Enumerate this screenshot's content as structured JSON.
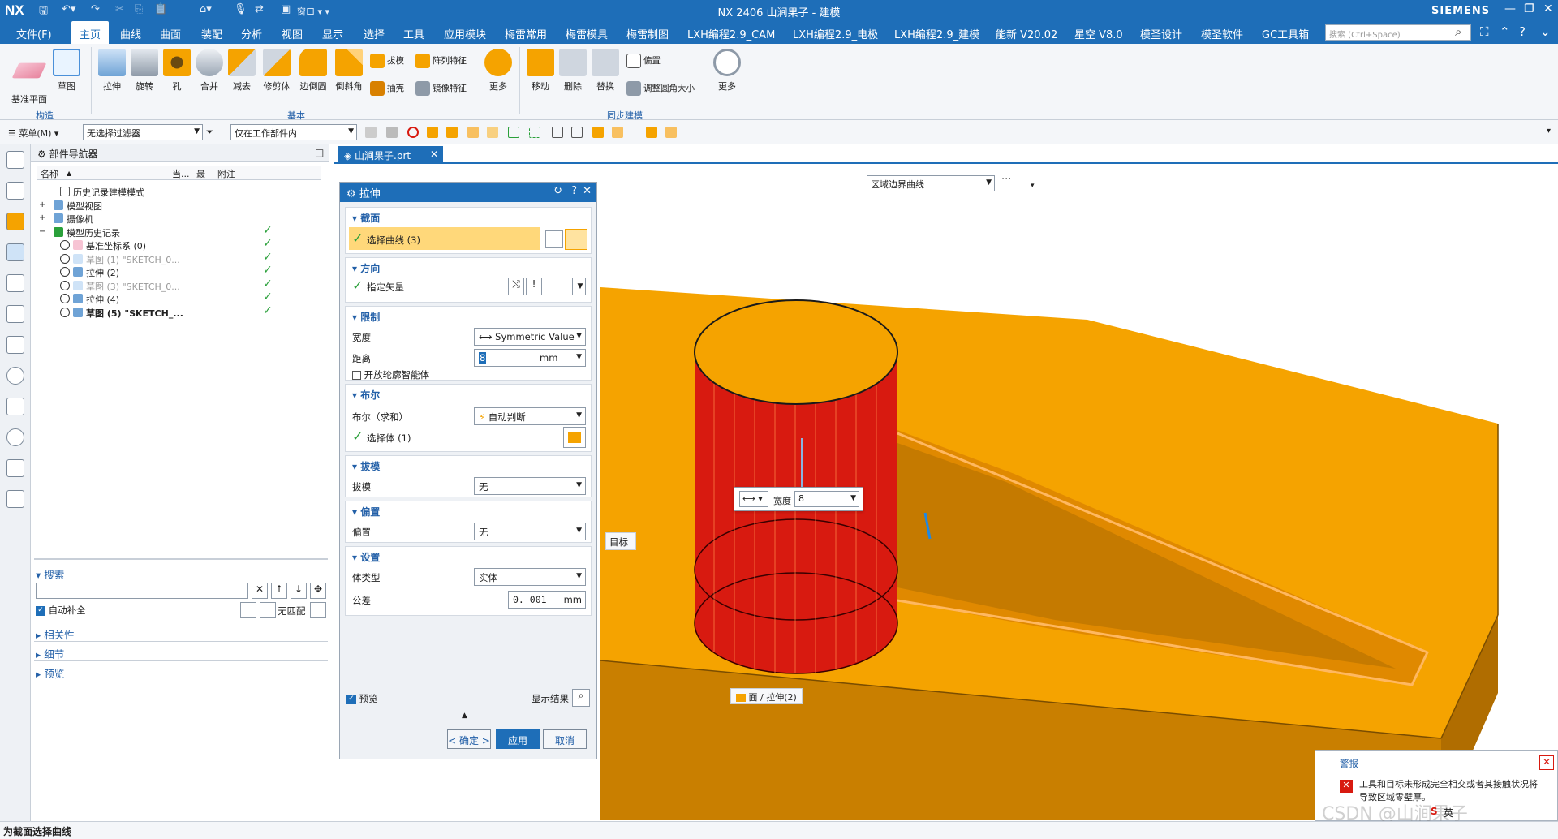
{
  "titlebar": {
    "logo": "NX",
    "window_menu": "窗口",
    "title": "NX 2406 山涧果子 - 建模",
    "brand": "SIEMENS"
  },
  "menubar": {
    "items": [
      "文件(F)",
      "主页",
      "曲线",
      "曲面",
      "装配",
      "分析",
      "视图",
      "显示",
      "选择",
      "工具",
      "应用模块",
      "梅雷常用",
      "梅雷模具",
      "梅雷制图",
      "LXH编程2.9_CAM",
      "LXH编程2.9_电极",
      "LXH编程2.9_建模",
      "能新 V20.02",
      "星空 V8.0",
      "模圣设计",
      "模圣软件",
      "GC工具箱"
    ],
    "search_placeholder": "搜索 (Ctrl+Space)"
  },
  "ribbon": {
    "construct": [
      "基准平面",
      "草图"
    ],
    "basic_large": [
      "拉伸",
      "旋转",
      "孔",
      "合并",
      "减去",
      "修剪体",
      "边倒圆",
      "倒斜角"
    ],
    "basic_small": [
      "拔模",
      "阵列特征",
      "抽壳",
      "镜像特征"
    ],
    "basic_more": "更多",
    "sync_large": [
      "移动",
      "删除",
      "替换"
    ],
    "sync_small": [
      "偏置",
      "调整圆角大小"
    ],
    "sync_more": "更多",
    "groups": [
      "构造",
      "基本",
      "同步建模"
    ]
  },
  "toolbar": {
    "menu": "菜单(M)",
    "filter": "无选择过滤器",
    "scope": "仅在工作部件内"
  },
  "navigator": {
    "title": "部件导航器",
    "columns": [
      "名称",
      "当...",
      "最",
      "附注"
    ],
    "rows": [
      {
        "label": "历史记录建模模式",
        "state": "normal",
        "check": ""
      },
      {
        "label": "模型视图",
        "state": "normal",
        "check": ""
      },
      {
        "label": "摄像机",
        "state": "normal",
        "check": ""
      },
      {
        "label": "模型历史记录",
        "state": "normal",
        "check": "✓"
      },
      {
        "label": "基准坐标系 (0)",
        "state": "normal",
        "check": "✓"
      },
      {
        "label": "草图 (1) \"SKETCH_0...",
        "state": "grey",
        "check": "✓"
      },
      {
        "label": "拉伸 (2)",
        "state": "normal",
        "check": "✓"
      },
      {
        "label": "草图 (3) \"SKETCH_0...",
        "state": "grey",
        "check": "✓"
      },
      {
        "label": "拉伸 (4)",
        "state": "normal",
        "check": "✓"
      },
      {
        "label": "草图 (5) \"SKETCH_...",
        "state": "bold",
        "check": "✓"
      }
    ],
    "search": {
      "title": "搜索",
      "autocomplete": "自动补全",
      "nomatch": "无匹配"
    },
    "sections": [
      "相关性",
      "细节",
      "预览"
    ]
  },
  "tab": {
    "label": "山涧果子.prt"
  },
  "viewport": {
    "filter": "区域边界曲线",
    "more": "···",
    "target": "目标",
    "face_tag": "面 / 拉伸(2)",
    "width_label": "宽度",
    "width_value": "8"
  },
  "dialog": {
    "title": "拉伸",
    "section": {
      "title": "截面",
      "select": "选择曲线 (3)"
    },
    "direction": {
      "title": "方向",
      "vector": "指定矢量"
    },
    "limits": {
      "title": "限制",
      "width": "宽度",
      "width_value": "Symmetric Value",
      "distance": "距离",
      "distance_value": "8",
      "unit": "mm",
      "open_profile": "开放轮廓智能体"
    },
    "boolean": {
      "title": "布尔",
      "label": "布尔（求和）",
      "value": "自动判断",
      "select_body": "选择体 (1)"
    },
    "draft": {
      "title": "拔模",
      "label": "拔模",
      "value": "无"
    },
    "offset": {
      "title": "偏置",
      "label": "偏置",
      "value": "无"
    },
    "settings": {
      "title": "设置",
      "body_type": "体类型",
      "body_value": "实体",
      "tolerance": "公差",
      "tolerance_value": "0. 001",
      "tol_unit": "mm"
    },
    "preview": "预览",
    "show_result": "显示结果",
    "ok": "< 确定 >",
    "apply": "应用",
    "cancel": "取消"
  },
  "alert": {
    "title": "警报",
    "message": "工具和目标未形成完全相交或者其接触状况将导致区域零壁厚。"
  },
  "watermark": "CSDN @山涧果子",
  "ime": "英",
  "status": "为截面选择曲线",
  "colors": {
    "accent": "#1e6eb8",
    "body": "#f5a300",
    "cylinder": "#d81a10",
    "check": "#2aa03a"
  }
}
